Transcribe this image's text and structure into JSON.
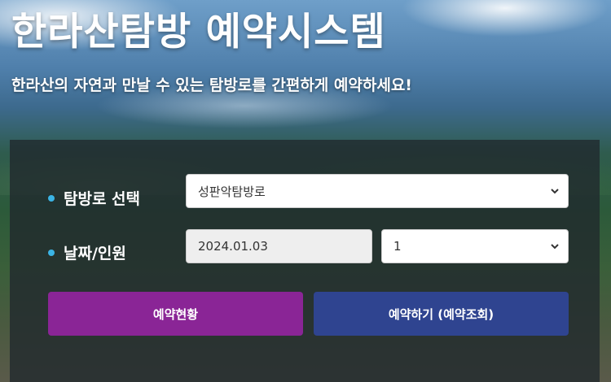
{
  "header": {
    "title": "한라산탐방 예약시스템",
    "subtitle": "한라산의 자연과 만날 수 있는 탐방로를 간편하게 예약하세요!"
  },
  "form": {
    "trail": {
      "label": "탐방로 선택",
      "selected": "성판악탐방로"
    },
    "date_people": {
      "label": "날짜/인원",
      "date_value": "2024.01.03",
      "people_selected": "1"
    }
  },
  "buttons": {
    "status": "예약현황",
    "reserve": "예약하기 (예약조회)"
  },
  "colors": {
    "bullet": "#3bb4e5",
    "status_button": "#8a2596",
    "reserve_button": "#2f4490"
  },
  "icons": {
    "select_arrow": "chevron-down-icon"
  }
}
